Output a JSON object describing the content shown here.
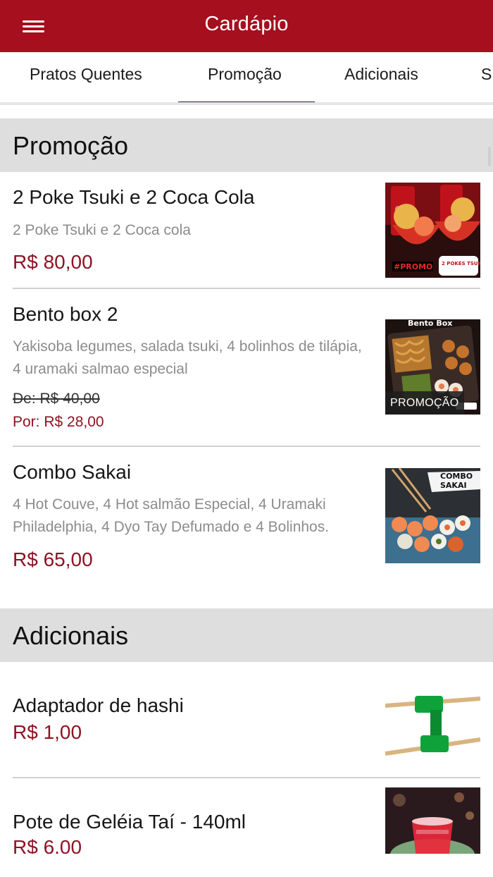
{
  "appbar": {
    "title": "Cardápio",
    "menu_icon": "hamburger-menu-icon"
  },
  "tabs": [
    {
      "label": "Pratos Quentes",
      "active": false
    },
    {
      "label": "Promoção",
      "active": true
    },
    {
      "label": "Adicionais",
      "active": false
    },
    {
      "label": "S",
      "active": false
    }
  ],
  "colors": {
    "primary": "#a50f1e",
    "price": "#8e1323",
    "tab_indicator": "#3a1a4a",
    "section_bg": "#dedede"
  },
  "sections": [
    {
      "title": "Promoção",
      "items": [
        {
          "name": "2 Poke Tsuki e 2 Coca Cola",
          "description": "2 Poke Tsuki e 2 Coca cola",
          "price": "R$ 80,00",
          "image_alt": "poke-coca-image"
        },
        {
          "name": "Bento box 2",
          "description": "Yakisoba legumes, salada tsuki, 4 bolinhos de tilápia, 4 uramaki salmao especial",
          "old_price": "De: R$ 40,00",
          "new_price": "Por: R$ 28,00",
          "badge": "PROMOÇÃO",
          "image_alt": "bento-box-image"
        },
        {
          "name": "Combo Sakai",
          "description": "4 Hot Couve, 4 Hot salmão Especial, 4 Uramaki Philadelphia, 4 Dyo Tay Defumado e 4 Bolinhos.",
          "price": "R$ 65,00",
          "image_alt": "combo-sakai-image"
        }
      ]
    },
    {
      "title": "Adicionais",
      "items": [
        {
          "name": "Adaptador de hashi",
          "price": "R$ 1,00",
          "image_alt": "hashi-adapter-image"
        },
        {
          "name": "Pote de Geléia Taí - 140ml",
          "price": "R$ 6,00",
          "image_alt": "geleia-pot-image"
        }
      ]
    }
  ],
  "images": {
    "poke_text_1": "#PROMO",
    "poke_text_2": "2 POKES TSUKI",
    "bento_text": "Bento Box",
    "combo_text_1": "COMBO",
    "combo_text_2": "SAKAI"
  }
}
